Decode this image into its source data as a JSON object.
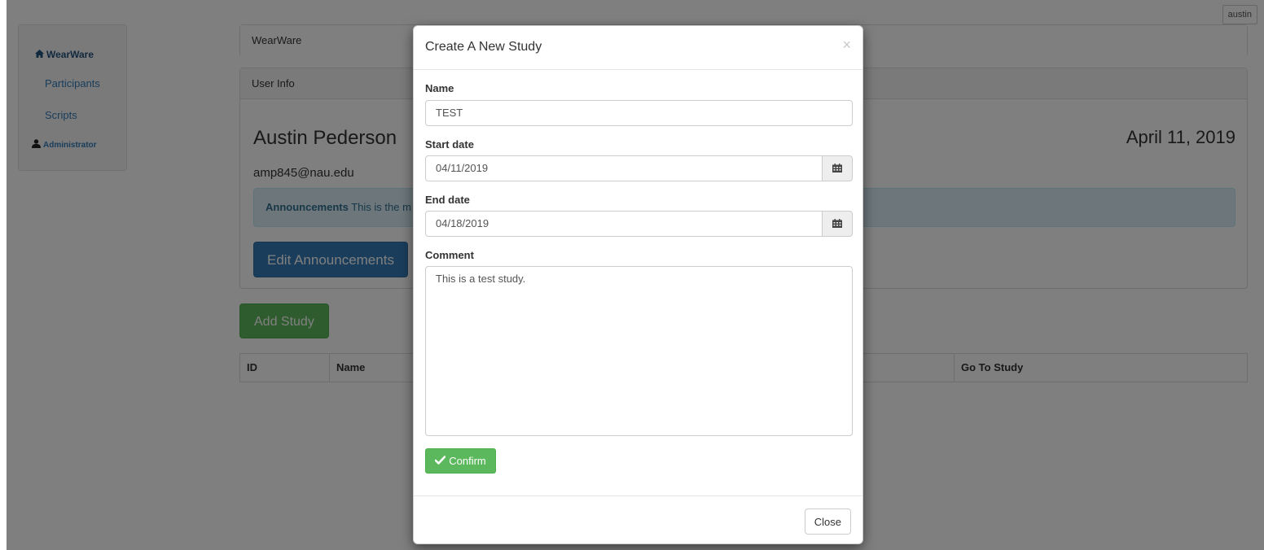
{
  "header": {
    "user_button": "austin"
  },
  "sidebar": {
    "brand": "WearWare",
    "items": [
      {
        "label": "Participants"
      },
      {
        "label": "Scripts"
      }
    ],
    "admin_label": "Administrator"
  },
  "main": {
    "wearware_heading": "WearWare",
    "user_info_heading": "User Info",
    "user_name": "Austin Pederson",
    "date": "April 11, 2019",
    "email": "amp845@nau.edu",
    "announcement_title": "Announcements",
    "announcement_text": "This is the m",
    "edit_announcements_label": "Edit Announcements",
    "add_study_label": "Add Study",
    "table_headers": [
      "ID",
      "Name",
      "Go To Study"
    ]
  },
  "modal": {
    "title": "Create A New Study",
    "close_x": "×",
    "name_label": "Name",
    "name_value": "TEST",
    "start_label": "Start date",
    "start_value": "04/11/2019",
    "end_label": "End date",
    "end_value": "04/18/2019",
    "comment_label": "Comment",
    "comment_value": "This is a test study.",
    "confirm_label": "Confirm",
    "close_label": "Close"
  },
  "colors": {
    "primary": "#337ab7",
    "success": "#5cb85c",
    "info_bg": "#d9edf7",
    "backdrop": "rgba(0,0,0,0.5)"
  }
}
